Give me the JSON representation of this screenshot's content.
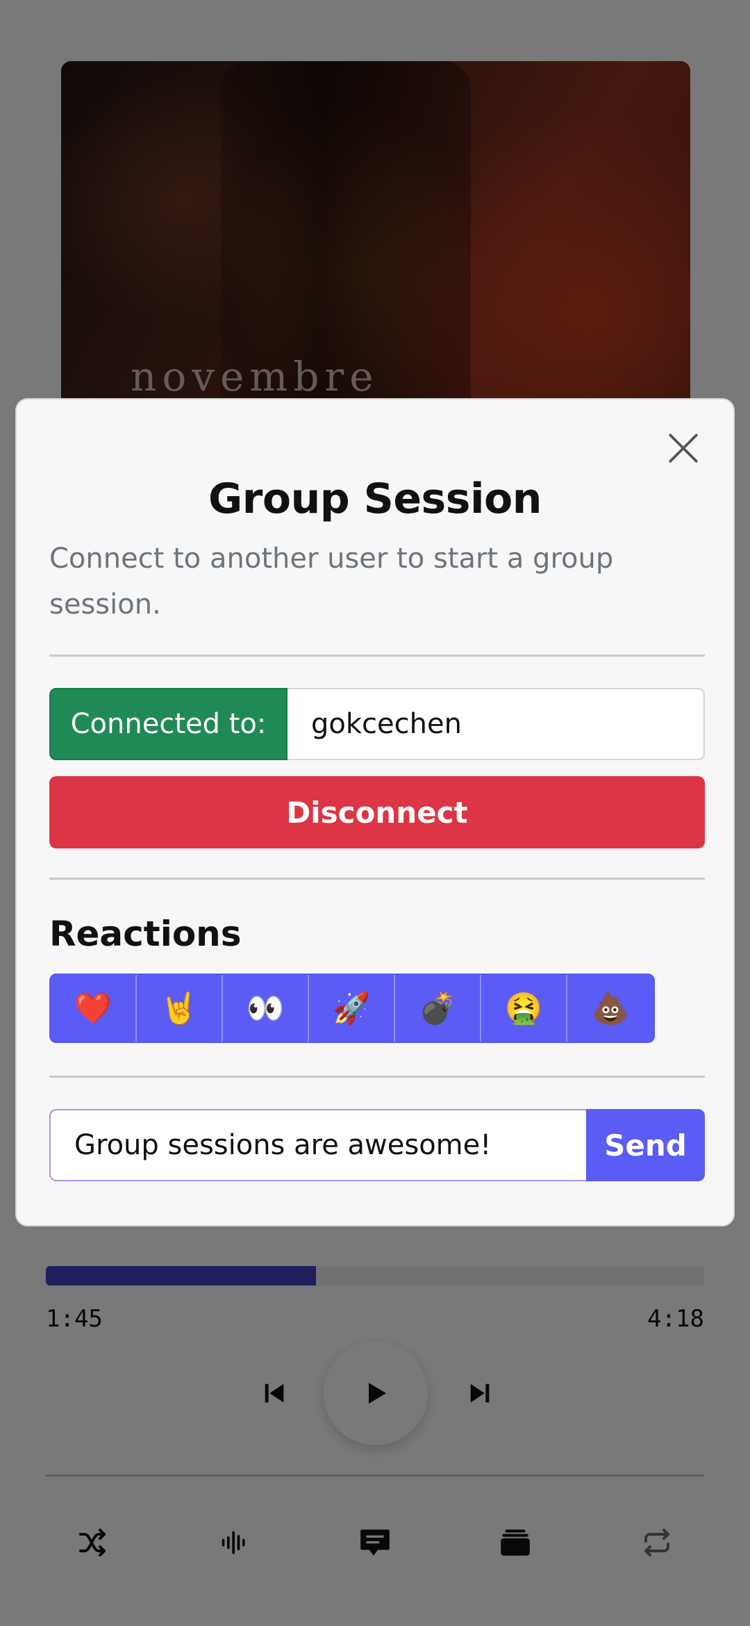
{
  "album": {
    "cover_text": "novembre"
  },
  "player": {
    "progress_fraction": 0.41,
    "elapsed": "1:45",
    "total": "4:18",
    "accent_color": "#3f3fb8"
  },
  "transport": {
    "prev_icon": "skip-previous-icon",
    "play_icon": "play-icon",
    "next_icon": "skip-next-icon"
  },
  "bottom_nav": {
    "items": [
      {
        "name": "shuffle",
        "icon": "shuffle-icon"
      },
      {
        "name": "audio",
        "icon": "waveform-icon"
      },
      {
        "name": "chat",
        "icon": "chat-icon"
      },
      {
        "name": "queue",
        "icon": "stack-icon"
      },
      {
        "name": "repeat",
        "icon": "repeat-icon"
      }
    ]
  },
  "modal": {
    "title": "Group Session",
    "subtitle": "Connect to another user to start a group session.",
    "close_icon": "close-icon",
    "connection": {
      "label": "Connected to:",
      "value": "gokcechen",
      "label_color": "#1f8a56"
    },
    "disconnect_label": "Disconnect",
    "disconnect_color": "#dc3545",
    "reactions_title": "Reactions",
    "reactions": [
      "❤️",
      "🤘",
      "👀",
      "🚀",
      "💣",
      "🤮",
      "💩"
    ],
    "message": {
      "value": "Group sessions are awesome!",
      "send_label": "Send"
    },
    "accent_color": "#5b5bf5"
  }
}
